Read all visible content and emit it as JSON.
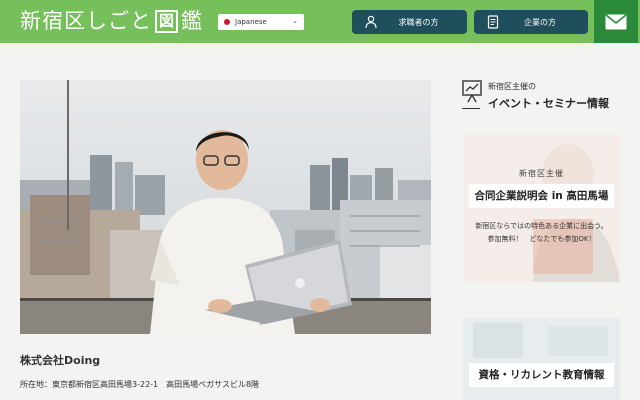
{
  "header": {
    "logo": {
      "main": "新宿区しごと",
      "zu": "図",
      "kan": "鑑"
    },
    "language": {
      "selected": "Japanese",
      "flag_color": "#d2142d"
    },
    "job_seeker_button": "求職者の方",
    "company_button": "企業の方",
    "mail_icon": "mail-icon",
    "accent_color": "#76c05b",
    "button_color": "#1f4e5c"
  },
  "main": {
    "company_name": "株式会社Doing",
    "address": "所在地：東京都新宿区高田馬場3-22-1　高田馬場ペガサスビル8階"
  },
  "sidebar": {
    "subtitle": "新宿区主催の",
    "title": "イベント・セミナー情報",
    "card1": {
      "sub": "新宿区主催",
      "title": "合同企業説明会 in 高田馬場",
      "desc_line1": "新宿区ならではの特色ある企業に出会う。",
      "desc_line2": "参加無料！　どなたでも参加OK！"
    },
    "card2": {
      "title": "資格・リカレント教育情報"
    }
  }
}
